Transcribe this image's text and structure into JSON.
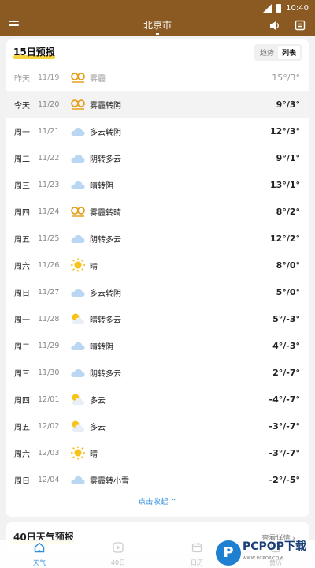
{
  "statusbar": {
    "time": "10:40"
  },
  "header": {
    "city": "北京市"
  },
  "forecast": {
    "title": "15日预报",
    "toggle": [
      {
        "label": "趋势",
        "active": false
      },
      {
        "label": "列表",
        "active": true
      }
    ],
    "rows": [
      {
        "day": "昨天",
        "date": "11/19",
        "icon": "haze-icon",
        "desc": "雾霾",
        "temp": "15°/3°",
        "past": true
      },
      {
        "day": "今天",
        "date": "11/20",
        "icon": "haze-icon",
        "desc": "雾霾转阴",
        "temp": "9°/3°",
        "today": true
      },
      {
        "day": "周一",
        "date": "11/21",
        "icon": "cloud-icon",
        "desc": "多云转阴",
        "temp": "12°/3°"
      },
      {
        "day": "周二",
        "date": "11/22",
        "icon": "cloud-icon",
        "desc": "阴转多云",
        "temp": "9°/1°"
      },
      {
        "day": "周三",
        "date": "11/23",
        "icon": "cloud-icon",
        "desc": "晴转阴",
        "temp": "13°/1°"
      },
      {
        "day": "周四",
        "date": "11/24",
        "icon": "haze-icon",
        "desc": "雾霾转晴",
        "temp": "8°/2°"
      },
      {
        "day": "周五",
        "date": "11/25",
        "icon": "cloud-icon",
        "desc": "阴转多云",
        "temp": "12°/2°"
      },
      {
        "day": "周六",
        "date": "11/26",
        "icon": "sun-icon",
        "desc": "晴",
        "temp": "8°/0°"
      },
      {
        "day": "周日",
        "date": "11/27",
        "icon": "cloud-icon",
        "desc": "多云转阴",
        "temp": "5°/0°"
      },
      {
        "day": "周一",
        "date": "11/28",
        "icon": "partly-cloudy-icon",
        "desc": "晴转多云",
        "temp": "5°/-3°"
      },
      {
        "day": "周二",
        "date": "11/29",
        "icon": "cloud-icon",
        "desc": "晴转阴",
        "temp": "4°/-3°"
      },
      {
        "day": "周三",
        "date": "11/30",
        "icon": "cloud-icon",
        "desc": "阴转多云",
        "temp": "2°/-7°"
      },
      {
        "day": "周四",
        "date": "12/01",
        "icon": "partly-cloudy-icon",
        "desc": "多云",
        "temp": "-4°/-7°"
      },
      {
        "day": "周五",
        "date": "12/02",
        "icon": "partly-cloudy-icon",
        "desc": "多云",
        "temp": "-3°/-7°"
      },
      {
        "day": "周六",
        "date": "12/03",
        "icon": "sun-icon",
        "desc": "晴",
        "temp": "-3°/-7°"
      },
      {
        "day": "周日",
        "date": "12/04",
        "icon": "cloud-icon",
        "desc": "雾霾转小雪",
        "temp": "-2°/-5°"
      }
    ],
    "collapse_label": "点击收起 ⌃"
  },
  "forecast40": {
    "title": "40日天气预报",
    "more_label": "查看详情 ›"
  },
  "nav": [
    {
      "label": "天气",
      "icon": "home-icon",
      "active": true
    },
    {
      "label": "40日",
      "icon": "play-icon",
      "active": false
    },
    {
      "label": "日历",
      "icon": "calendar-icon",
      "active": false
    },
    {
      "label": "黄历",
      "icon": "almanac-icon",
      "active": false
    }
  ],
  "watermark": {
    "badge": "P",
    "brand": "PCPOP下载",
    "sub": "WWW.PCPOP.COM"
  },
  "colors": {
    "header": "#8a5a22",
    "accent": "#2f8ee0",
    "highlight": "#f5c400"
  }
}
